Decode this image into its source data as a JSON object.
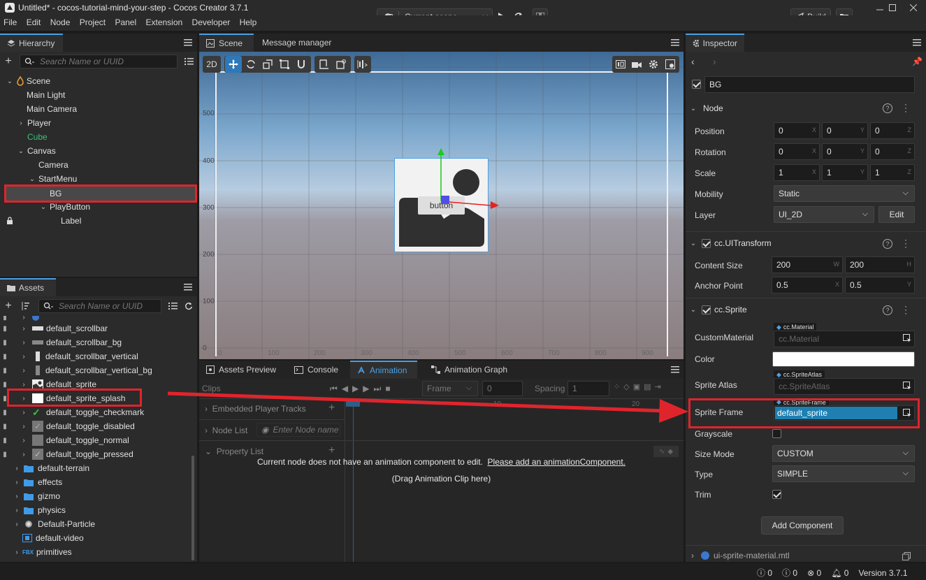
{
  "window": {
    "title": "Untitled* - cocos-tutorial-mind-your-step - Cocos Creator 3.7.1",
    "scene_select": "Current scene",
    "build_label": "Build"
  },
  "menu": [
    "File",
    "Edit",
    "Node",
    "Project",
    "Panel",
    "Extension",
    "Developer",
    "Help"
  ],
  "hierarchy": {
    "tab": "Hierarchy",
    "search_placeholder": "Search Name or UUID",
    "items": [
      {
        "label": "Scene"
      },
      {
        "label": "Main Light"
      },
      {
        "label": "Main Camera"
      },
      {
        "label": "Player"
      },
      {
        "label": "Cube"
      },
      {
        "label": "Canvas"
      },
      {
        "label": "Camera"
      },
      {
        "label": "StartMenu"
      },
      {
        "label": "BG"
      },
      {
        "label": "PlayButton"
      },
      {
        "label": "Label"
      }
    ]
  },
  "assets": {
    "tab": "Assets",
    "search_placeholder": "Search Name or UUID",
    "items": [
      {
        "label": "default_scrollbar"
      },
      {
        "label": "default_scrollbar_bg"
      },
      {
        "label": "default_scrollbar_vertical"
      },
      {
        "label": "default_scrollbar_vertical_bg"
      },
      {
        "label": "default_sprite"
      },
      {
        "label": "default_sprite_splash"
      },
      {
        "label": "default_toggle_checkmark"
      },
      {
        "label": "default_toggle_disabled"
      },
      {
        "label": "default_toggle_normal"
      },
      {
        "label": "default_toggle_pressed"
      },
      {
        "label": "default-terrain"
      },
      {
        "label": "effects"
      },
      {
        "label": "gizmo"
      },
      {
        "label": "physics"
      },
      {
        "label": "Default-Particle"
      },
      {
        "label": "default-video"
      },
      {
        "label": "primitives"
      }
    ],
    "fbx_badge": "FBX"
  },
  "scene": {
    "tabs": [
      "Scene",
      "Message manager"
    ],
    "mode_2d": "2D",
    "y_ticks": [
      "500",
      "400",
      "300",
      "200",
      "100",
      "0"
    ],
    "x_ticks": [
      "0",
      "100",
      "200",
      "300",
      "400",
      "500",
      "600",
      "700",
      "800",
      "900"
    ],
    "button_label": "button"
  },
  "bottom": {
    "tabs": [
      "Assets Preview",
      "Console",
      "Animation",
      "Animation Graph"
    ],
    "clips_label": "Clips",
    "frame_label": "Frame",
    "frame_value": "0",
    "spacing_label": "Spacing",
    "spacing_value": "1",
    "embedded_tracks": "Embedded Player Tracks",
    "node_list": "Node List",
    "node_filter_placeholder": "Enter Node name",
    "property_list": "Property List",
    "ruler_10": "10",
    "ruler_20": "20",
    "message": "Current node does not have an animation component to edit.",
    "link": "Please add an animationComponent.",
    "drag_hint": "(Drag Animation Clip here)"
  },
  "inspector": {
    "tab": "Inspector",
    "node_name": "BG",
    "node_section": "Node",
    "position": {
      "label": "Position",
      "x": "0",
      "y": "0",
      "z": "0"
    },
    "rotation": {
      "label": "Rotation",
      "x": "0",
      "y": "0",
      "z": "0"
    },
    "scale": {
      "label": "Scale",
      "x": "1",
      "y": "1",
      "z": "1"
    },
    "mobility": {
      "label": "Mobility",
      "value": "Static"
    },
    "layer": {
      "label": "Layer",
      "value": "UI_2D",
      "edit": "Edit"
    },
    "uitransform": {
      "title": "cc.UITransform",
      "content_size_label": "Content Size",
      "w": "200",
      "h": "200",
      "anchor_label": "Anchor Point",
      "ax": "0.5",
      "ay": "0.5"
    },
    "sprite": {
      "title": "cc.Sprite",
      "custom_material_label": "CustomMaterial",
      "custom_material_tag": "cc.Material",
      "custom_material_value": "cc.Material",
      "color_label": "Color",
      "color_value": "#ffffff",
      "sprite_atlas_label": "Sprite Atlas",
      "sprite_atlas_tag": "cc.SpriteAtlas",
      "sprite_atlas_value": "cc.SpriteAtlas",
      "sprite_frame_label": "Sprite Frame",
      "sprite_frame_tag": "cc.SpriteFrame",
      "sprite_frame_value": "default_sprite",
      "grayscale_label": "Grayscale",
      "size_mode_label": "Size Mode",
      "size_mode_value": "CUSTOM",
      "type_label": "Type",
      "type_value": "SIMPLE",
      "trim_label": "Trim"
    },
    "add_component": "Add Component",
    "material_file": "ui-sprite-material.mtl"
  },
  "status": {
    "info": "0",
    "warn": "0",
    "error": "0",
    "notify": "0",
    "version": "Version 3.7.1"
  },
  "colors": {
    "accent": "#4aa0e6",
    "highlight_box": "#e0242c",
    "cube_green": "#3cc07a",
    "sprite_frame_bg": "#1e7fb0"
  }
}
